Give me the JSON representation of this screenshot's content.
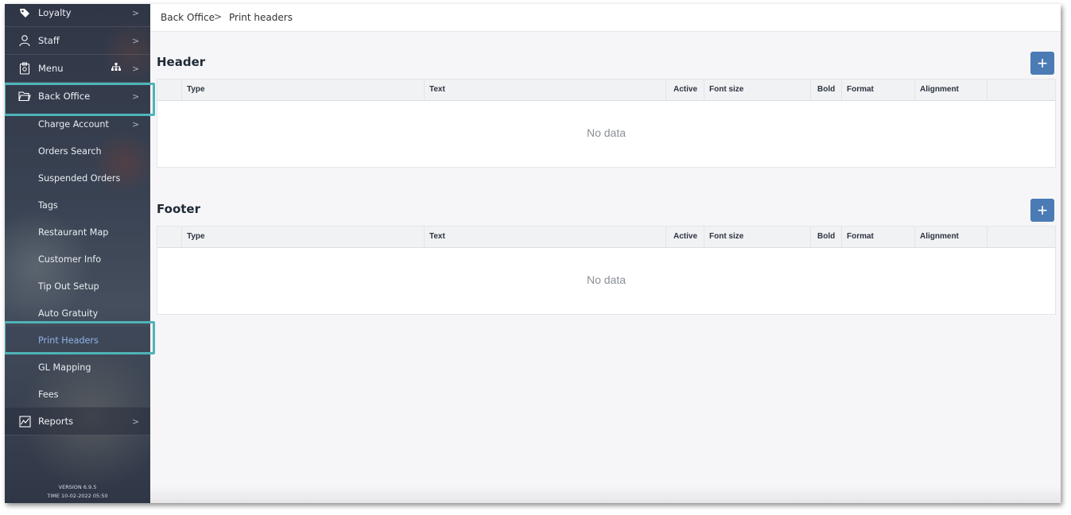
{
  "sidebar": {
    "items": [
      {
        "label": "Loyalty",
        "icon": "tag-icon"
      },
      {
        "label": "Staff",
        "icon": "user-icon"
      },
      {
        "label": "Menu",
        "icon": "menu-clipboard-icon"
      },
      {
        "label": "Back Office",
        "icon": "folder-icon"
      }
    ],
    "subitems": [
      {
        "label": "Charge Account"
      },
      {
        "label": "Orders Search"
      },
      {
        "label": "Suspended Orders"
      },
      {
        "label": "Tags"
      },
      {
        "label": "Restaurant Map"
      },
      {
        "label": "Customer Info"
      },
      {
        "label": "Tip Out Setup"
      },
      {
        "label": "Auto Gratuity"
      },
      {
        "label": "Print Headers"
      },
      {
        "label": "GL Mapping"
      },
      {
        "label": "Fees"
      }
    ],
    "reports": {
      "label": "Reports",
      "icon": "chart-icon"
    },
    "chevron": ">",
    "version": "VERSION 6.9.5",
    "time": "TIME 10-02-2022 05:50",
    "highlight_color": "#4fb4b8",
    "active_color": "#8fb4e8"
  },
  "breadcrumb": {
    "root": "Back Office",
    "separator": ">",
    "current": "Print headers"
  },
  "header_section": {
    "title": "Header",
    "add_label": "+",
    "columns": [
      "Type",
      "Text",
      "Active",
      "Font size",
      "Bold",
      "Format",
      "Alignment"
    ],
    "empty_text": "No data"
  },
  "footer_section": {
    "title": "Footer",
    "add_label": "+",
    "columns": [
      "Type",
      "Text",
      "Active",
      "Font size",
      "Bold",
      "Format",
      "Alignment"
    ],
    "empty_text": "No data"
  },
  "colors": {
    "accent": "#4a7bb5"
  }
}
